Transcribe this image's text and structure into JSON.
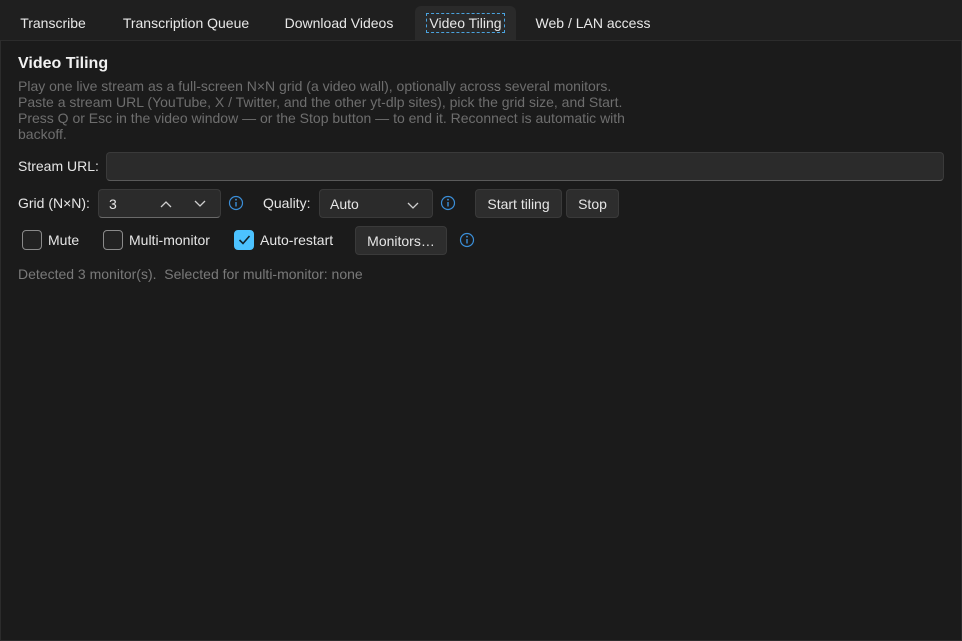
{
  "tabs": [
    {
      "label": "Transcribe",
      "active": false
    },
    {
      "label": "Transcription Queue",
      "active": false
    },
    {
      "label": "Download Videos",
      "active": false
    },
    {
      "label": "Video Tiling",
      "active": true
    },
    {
      "label": "Web / LAN access",
      "active": false
    }
  ],
  "page": {
    "title": "Video Tiling",
    "description_lines": [
      "Play one live stream as a full-screen N×N grid (a video wall), optionally across several monitors.",
      "Paste a stream URL (YouTube, X / Twitter, and the other yt-dlp sites), pick the grid size, and Start.",
      "Press Q or Esc in the video window — or the Stop button — to end it. Reconnect is automatic with",
      "backoff."
    ]
  },
  "stream": {
    "label": "Stream URL:",
    "value": "",
    "placeholder": ""
  },
  "grid": {
    "label": "Grid (N×N):",
    "value": "3"
  },
  "quality": {
    "label": "Quality:",
    "selected": "Auto"
  },
  "buttons": {
    "start": "Start tiling",
    "stop": "Stop",
    "monitors": "Monitors…"
  },
  "options": {
    "mute": {
      "label": "Mute",
      "checked": false
    },
    "multi_monitor": {
      "label": "Multi-monitor",
      "checked": false
    },
    "auto_restart": {
      "label": "Auto-restart",
      "checked": true
    }
  },
  "status": {
    "text": "Detected 3 monitor(s).  Selected for multi-monitor: none"
  },
  "colors": {
    "accent": "#4cc2ff",
    "info_icon": "#3b8fd9",
    "background": "#1b1b1b"
  }
}
